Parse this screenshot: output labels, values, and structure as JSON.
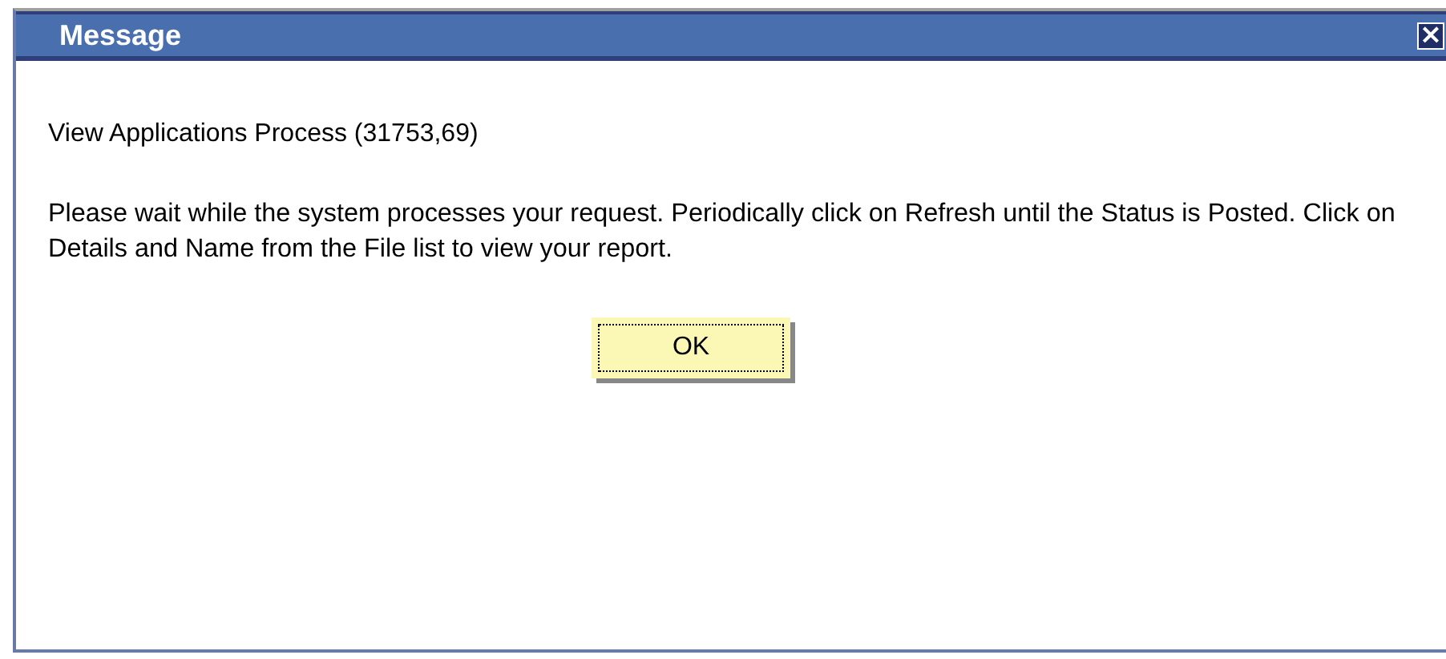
{
  "window": {
    "title": "Message",
    "close_label": "×"
  },
  "heading": "View Applications Process (31753,69)",
  "message": "Please wait while the system processes your request.  Periodically click on Refresh until the Status is Posted.  Click on Details and Name from the File list to view your report.",
  "buttons": [
    {
      "label": "OK",
      "focused": true
    }
  ]
}
